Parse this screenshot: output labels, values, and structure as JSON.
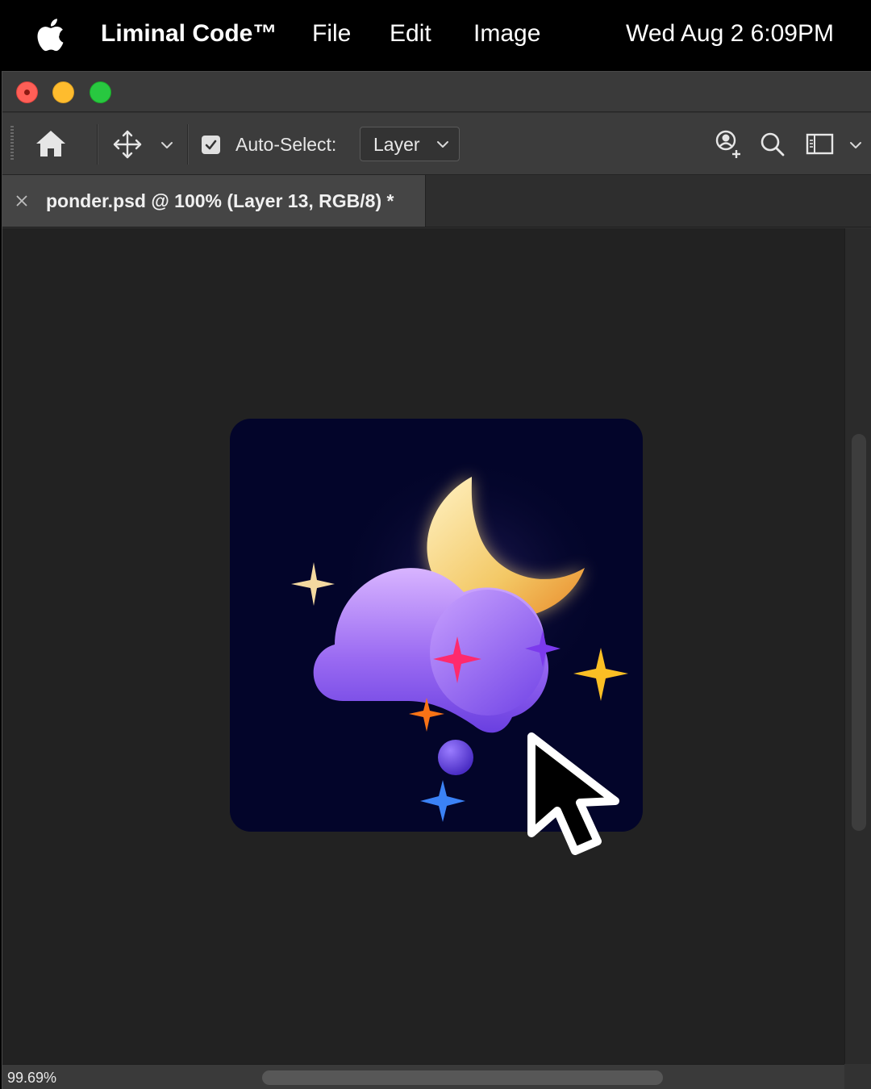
{
  "menubar": {
    "apple_icon": "apple-logo-icon",
    "app_name": "Liminal Code™",
    "menus": [
      "File",
      "Edit",
      "Image"
    ],
    "clock": "Wed Aug 2  6:09PM"
  },
  "window": {
    "traffic_lights": {
      "close": "#fe5f57",
      "minimize": "#febc2e",
      "maximize": "#28c840"
    }
  },
  "options_bar": {
    "home_icon": "home-icon",
    "move_tool_icon": "move-tool-icon",
    "auto_select_checked": true,
    "auto_select_label": "Auto-Select:",
    "auto_select_value": "Layer",
    "right_icons": [
      "share-user-icon",
      "search-icon",
      "workspace-icon"
    ]
  },
  "document_tab": {
    "title": "ponder.psd @ 100% (Layer 13, RGB/8) *"
  },
  "canvas": {
    "background": "#222222",
    "artwork_background": "#03052a",
    "artwork_elements": [
      "moon-icon",
      "cloud-icon",
      "sparkle-icon",
      "pointer-cursor-icon"
    ]
  },
  "status_bar": {
    "zoom": "99.69%"
  }
}
